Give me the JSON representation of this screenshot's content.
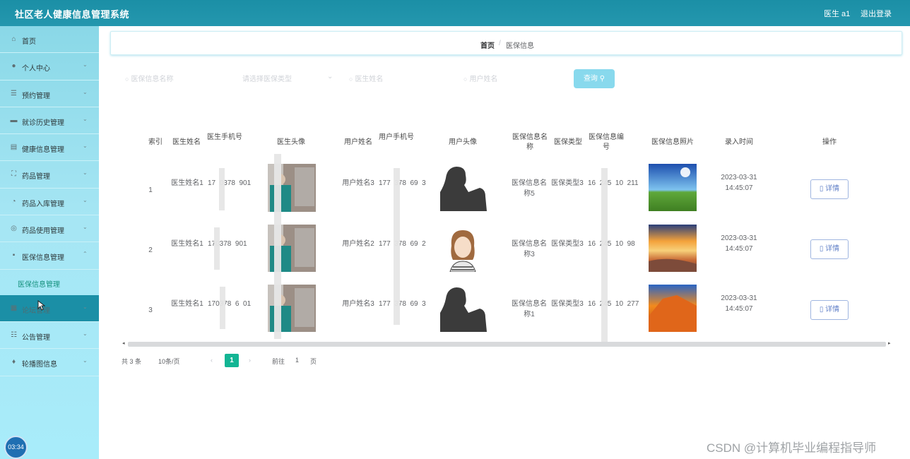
{
  "app": {
    "title": "社区老人健康信息管理系统",
    "user_label": "医生 a1",
    "logout_label": "退出登录"
  },
  "sidebar": {
    "items": [
      {
        "label": "首页",
        "icon": "home-icon"
      },
      {
        "label": "个人中心",
        "icon": "user-icon"
      },
      {
        "label": "预约管理",
        "icon": "list-icon"
      },
      {
        "label": "就诊历史管理",
        "icon": "monitor-icon"
      },
      {
        "label": "健康信息管理",
        "icon": "document-icon"
      },
      {
        "label": "药品管理",
        "icon": "scan-icon"
      },
      {
        "label": "药品入库管理",
        "icon": "gauge-icon"
      },
      {
        "label": "药品使用管理",
        "icon": "target-icon"
      },
      {
        "label": "医保信息管理",
        "icon": "message-icon"
      },
      {
        "label": "论坛管理",
        "icon": "grid-icon"
      },
      {
        "label": "公告管理",
        "icon": "sliders-icon"
      },
      {
        "label": "轮播图信息",
        "icon": "microphone-icon"
      }
    ],
    "submenu_label": "医保信息管理",
    "timer": "03:34"
  },
  "breadcrumb": {
    "home": "首页",
    "separator": "/",
    "current": "医保信息"
  },
  "search": {
    "name_placeholder": "医保信息名称",
    "type_placeholder": "请选择医保类型",
    "doctor_placeholder": "医生姓名",
    "user_placeholder": "用户姓名",
    "button_label": "查询"
  },
  "table": {
    "headers": [
      "索引",
      "医生姓名",
      "医生手机号",
      "医生头像",
      "用户姓名",
      "用户手机号",
      "用户头像",
      "医保信息名称",
      "医保类型",
      "医保信息编号",
      "医保信息照片",
      "录入时间",
      "操作"
    ],
    "rows": [
      {
        "index": "1",
        "doctor_name": "医生姓名1",
        "doctor_phone": "17  0378  901",
        "user_name": "用户姓名3",
        "user_phone": "177  378  69  3",
        "ins_name": "医保信息名称5",
        "ins_type": "医保类型3",
        "ins_no": "16  245  10  211",
        "time": "2023-03-31 14:45:07",
        "action": "详情"
      },
      {
        "index": "2",
        "doctor_name": "医生姓名1",
        "doctor_phone": "170378  901",
        "user_name": "用户姓名2",
        "user_phone": "177  378  69  2",
        "ins_name": "医保信息名称3",
        "ins_type": "医保类型3",
        "ins_no": "16  245  10  98",
        "time": "2023-03-31 14:45:07",
        "action": "详情"
      },
      {
        "index": "3",
        "doctor_name": "医生姓名1",
        "doctor_phone": "170378  6  01",
        "user_name": "用户姓名3",
        "user_phone": "177  378  69  3",
        "ins_name": "医保信息名称1",
        "ins_type": "医保类型3",
        "ins_no": "16  245  10  277",
        "time": "2023-03-31 14:45:07",
        "action": "详情"
      }
    ]
  },
  "pagination": {
    "total": "共 3 条",
    "page_size": "10条/页",
    "current_page": "1",
    "goto_prefix": "前往",
    "goto_value": "1",
    "goto_suffix": "页"
  },
  "watermark": "CSDN @计算机毕业编程指导师",
  "colors": {
    "header": "#1b8fa6",
    "sidebar": "#a6e6f4",
    "active_page": "#13b594",
    "search_button": "#88d9ed"
  }
}
